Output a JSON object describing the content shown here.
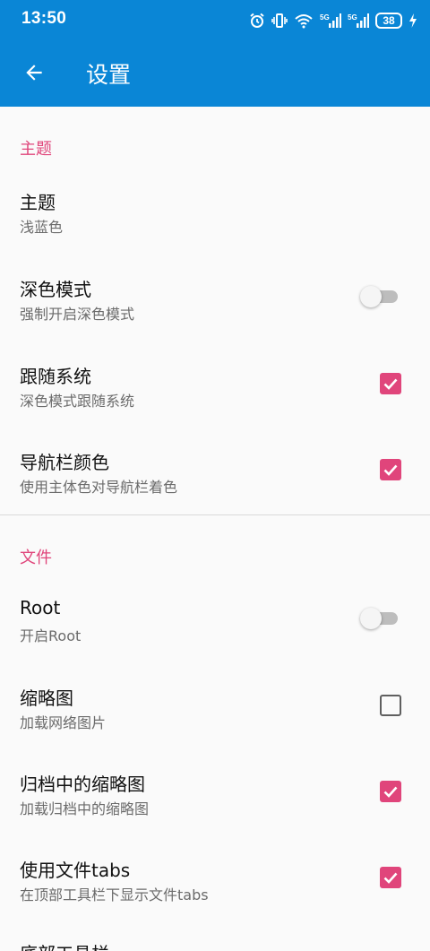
{
  "status_bar": {
    "time": "13:50",
    "battery": "38",
    "icons": [
      "alarm-icon",
      "vibrate-icon",
      "wifi-icon",
      "signal-5g-icon",
      "signal-5g-icon",
      "battery-icon",
      "charging-icon"
    ]
  },
  "app_bar": {
    "title": "设置",
    "back_icon": "arrow-left-icon"
  },
  "colors": {
    "primary": "#0a86d6",
    "accent": "#e0457b"
  },
  "sections": [
    {
      "header": "主题",
      "items": [
        {
          "title": "主题",
          "subtitle": "浅蓝色",
          "control": "none"
        },
        {
          "title": "深色模式",
          "subtitle": "强制开启深色模式",
          "control": "switch",
          "checked": false
        },
        {
          "title": "跟随系统",
          "subtitle": "深色模式跟随系统",
          "control": "checkbox",
          "checked": true
        },
        {
          "title": "导航栏颜色",
          "subtitle": "使用主体色对导航栏着色",
          "control": "checkbox",
          "checked": true
        }
      ]
    },
    {
      "header": "文件",
      "items": [
        {
          "title": "Root",
          "subtitle": "开启Root",
          "control": "switch",
          "checked": false
        },
        {
          "title": "缩略图",
          "subtitle": "加载网络图片",
          "control": "checkbox",
          "checked": false
        },
        {
          "title": "归档中的缩略图",
          "subtitle": "加载归档中的缩略图",
          "control": "checkbox",
          "checked": true
        },
        {
          "title": "使用文件tabs",
          "subtitle": "在顶部工具栏下显示文件tabs",
          "control": "checkbox",
          "checked": true
        },
        {
          "title": "底部工具栏",
          "subtitle": "",
          "control": "none"
        }
      ]
    }
  ]
}
